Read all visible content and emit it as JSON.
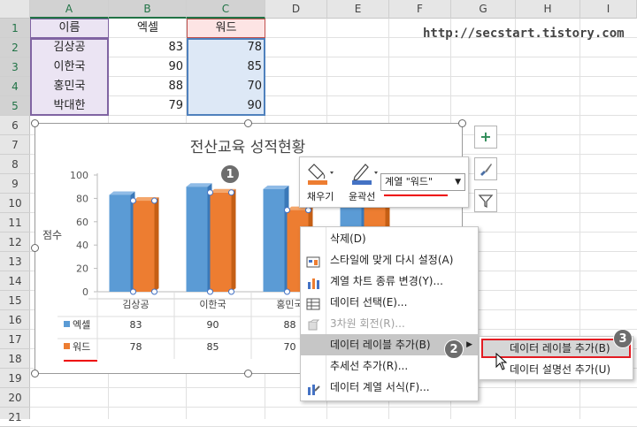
{
  "columns": [
    "A",
    "B",
    "C",
    "D",
    "E",
    "F",
    "G",
    "H",
    "I"
  ],
  "rows": [
    "1",
    "2",
    "3",
    "4",
    "5",
    "6",
    "7",
    "8",
    "9",
    "10",
    "11",
    "12",
    "13",
    "14",
    "15",
    "16",
    "17",
    "18",
    "19",
    "20",
    "21"
  ],
  "sheet": {
    "header": [
      "이름",
      "엑셀",
      "워드"
    ],
    "data": [
      [
        "김상공",
        "83",
        "78"
      ],
      [
        "이한국",
        "90",
        "85"
      ],
      [
        "홍민국",
        "88",
        "70"
      ],
      [
        "박대한",
        "79",
        "90"
      ]
    ],
    "url_text": "http://secstart.tistory.com"
  },
  "chart_data": {
    "type": "bar",
    "title": "전산교육 성적현황",
    "ylabel": "점수",
    "ylim": [
      0,
      100
    ],
    "yticks": [
      "0",
      "20",
      "40",
      "60",
      "80",
      "100"
    ],
    "categories": [
      "김상공",
      "이한국",
      "홍민국",
      "박대한"
    ],
    "series": [
      {
        "name": "엑셀",
        "values": [
          83,
          90,
          88,
          79
        ],
        "color": "#5b9bd5"
      },
      {
        "name": "워드",
        "values": [
          78,
          85,
          70,
          90
        ],
        "color": "#ed7d31"
      }
    ],
    "table_rows": [
      {
        "name": "엑셀",
        "values": [
          "83",
          "90",
          "88"
        ]
      },
      {
        "name": "워드",
        "values": [
          "78",
          "85",
          "70"
        ]
      }
    ]
  },
  "side_buttons": {
    "plus": "+",
    "brush": "brush-icon",
    "filter": "filter-icon"
  },
  "minibar": {
    "fill_label": "채우기",
    "outline_label": "윤곽선",
    "series_select": "계열 \"워드\""
  },
  "context_menu": {
    "items": [
      {
        "label": "삭제(D)",
        "icon": "",
        "disabled": false
      },
      {
        "label": "스타일에 맞게 다시 설정(A)",
        "icon": "reset-style-icon",
        "disabled": false
      },
      {
        "label": "계열 차트 종류 변경(Y)...",
        "icon": "chart-type-icon",
        "disabled": false
      },
      {
        "label": "데이터 선택(E)...",
        "icon": "data-select-icon",
        "disabled": false
      },
      {
        "label": "3차원 회전(R)...",
        "icon": "rotate-3d-icon",
        "disabled": true
      },
      {
        "label": "데이터 레이블 추가(B)",
        "icon": "",
        "disabled": false
      },
      {
        "label": "추세선 추가(R)...",
        "icon": "",
        "disabled": false
      },
      {
        "label": "데이터 계열 서식(F)...",
        "icon": "format-series-icon",
        "disabled": false
      }
    ]
  },
  "submenu": {
    "items": [
      {
        "label": "데이터 레이블 추가(B)"
      },
      {
        "label": "데이터 설명선 추가(U)"
      }
    ]
  },
  "badges": [
    "1",
    "2",
    "3"
  ]
}
